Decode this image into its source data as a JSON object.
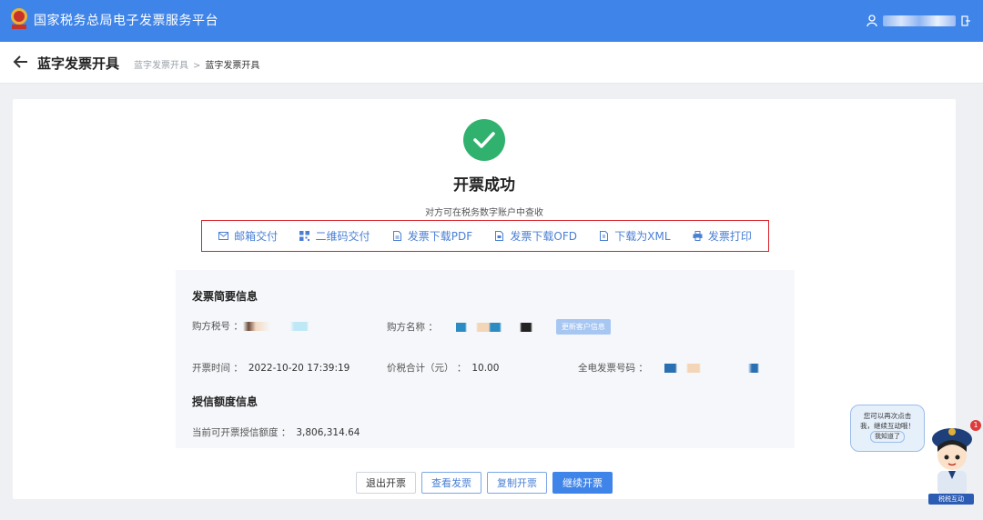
{
  "header": {
    "app_title": "国家税务总局电子发票服务平台"
  },
  "subheader": {
    "page_title": "蓝字发票开具",
    "breadcrumb": [
      "蓝字发票开具",
      "蓝字发票开具"
    ]
  },
  "result": {
    "title": "开票成功",
    "subtitle": "对方可在税务数字账户中查收"
  },
  "actions": [
    {
      "label": "邮箱交付",
      "icon": "mail-icon"
    },
    {
      "label": "二维码交付",
      "icon": "qrcode-icon"
    },
    {
      "label": "发票下载PDF",
      "icon": "pdf-file-icon"
    },
    {
      "label": "发票下载OFD",
      "icon": "ofd-file-icon"
    },
    {
      "label": "下载为XML",
      "icon": "xml-file-icon"
    },
    {
      "label": "发票打印",
      "icon": "printer-icon"
    }
  ],
  "invoice_summary": {
    "title": "发票简要信息",
    "buyer_tax_id_label": "购方税号 ：",
    "buyer_name_label": "购方名称 ：",
    "update_customer_label": "更新客户信息",
    "issue_time_label": "开票时间 ：",
    "issue_time": "2022-10-20 17:39:19",
    "total_label": "价税合计（元） ：",
    "total": "10.00",
    "invoice_no_label": "全电发票号码 ："
  },
  "credit_info": {
    "title": "授信额度信息",
    "available_label": "当前可开票授信额度 ：",
    "available": "3,806,314.64"
  },
  "buttons": {
    "exit": "退出开票",
    "view": "查看发票",
    "copy": "复制开票",
    "continue": "继续开票"
  },
  "assistant": {
    "bubble_line1": "您可以再次点击",
    "bubble_line2": "我，继续互动哦！",
    "bubble_ok": "我知道了",
    "badge": "1",
    "label": "税税互动"
  },
  "colors": {
    "header_bg": "#3f84e8",
    "success": "#30b26e",
    "highlight_border": "#d9232b",
    "link": "#4a7fd4"
  }
}
